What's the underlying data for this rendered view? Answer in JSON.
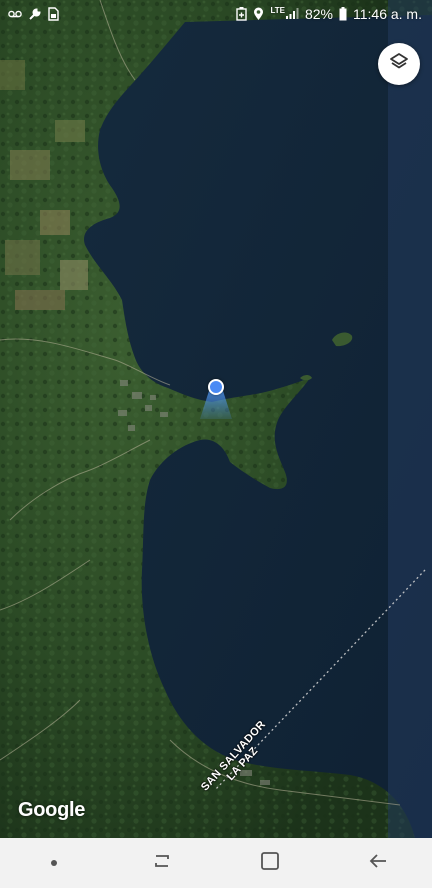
{
  "status_bar": {
    "battery_percent": "82%",
    "time": "11:46 a. m.",
    "network": "LTE",
    "left_icons": [
      "voicemail-icon",
      "wrench-icon",
      "sim-card-icon"
    ],
    "right_icons": [
      "battery-saver-icon",
      "location-icon",
      "lte-signal-icon",
      "battery-icon"
    ]
  },
  "map": {
    "border_label_line1": "SAN SALVADOR",
    "border_label_line2": "LA PAZ",
    "attribution": "Google",
    "layers_icon": "layers-icon",
    "my_location_icon": "blue-dot-icon"
  },
  "colors": {
    "lake": "#13273a",
    "land": "#2a4a25",
    "location_dot": "#4a8af4",
    "nav_bar": "#f2f2f2"
  },
  "nav_bar": {
    "icons": [
      "dot-icon",
      "recent-apps-icon",
      "home-icon",
      "back-icon"
    ]
  }
}
